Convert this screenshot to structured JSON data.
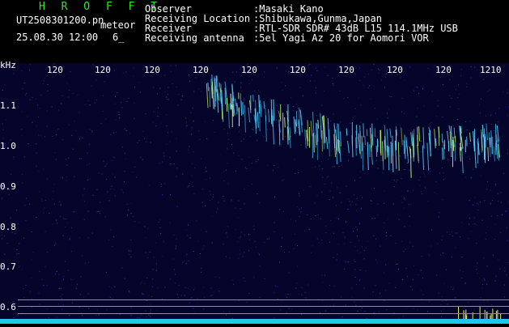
{
  "header": {
    "brand": "H R O F F T",
    "filename": "UT2508301200.pn",
    "tag": "meteor",
    "datetime": "25.08.30 12:00",
    "count": "6_",
    "rows": [
      {
        "label": "Observer",
        "value": ":Masaki Kano"
      },
      {
        "label": "Receiving Location",
        "value": ":Shibukawa,Gunma,Japan"
      },
      {
        "label": "Receiver",
        "value": ":RTL-SDR SDR# 43dB L15 114.1MHz USB"
      },
      {
        "label": "Receiving antenna",
        "value": ":5el Yagi Az 20 for Aomori VOR"
      }
    ]
  },
  "axis": {
    "unit": "kHz",
    "ylabels": [
      "1.1",
      "1.0",
      "0.9",
      "0.8",
      "0.7",
      "0.6"
    ],
    "time_ticks": [
      "120",
      "120",
      "120",
      "120",
      "120",
      "120",
      "120",
      "120",
      "120",
      "1210"
    ]
  },
  "colors": {
    "background": "#05052b",
    "brand": "#2ee82e",
    "signal": "#4fd2ff"
  }
}
